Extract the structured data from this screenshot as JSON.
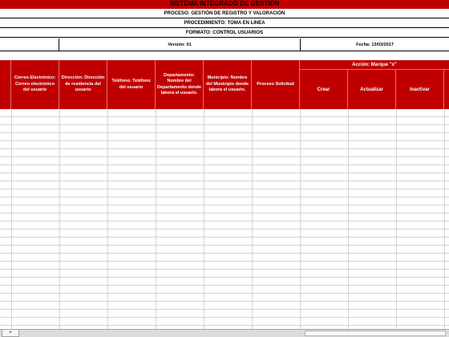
{
  "header": {
    "system_title": "SISTEMA INTEGRADO DE GESTIÓN",
    "proceso": "PROCESO: GESTIÓN DE REGISTRO Y VALORACIÓN",
    "procedimiento": "PROCEDIMIENTO: TOMA EN LINEA",
    "formato": "FORMATO: CONTROL USUARIOS",
    "version": "Versión: 01",
    "fecha": "Fecha: 13/03/2017"
  },
  "table": {
    "columns": [
      "Correo Electrónico: Correo electrónico del usuario",
      "Dirección: Dirección de residencia del usuario",
      "Teléfono: Teléfono del usuario",
      "Departamento: Nombre del Departamento donde labora el usuario.",
      "Municipio: Nombre del Municipio donde labora el usuario.",
      "Proceso Solicitud"
    ],
    "accion_title": "Acción: Marque \"x\"",
    "accion_options": [
      "Crear",
      "Actualizar",
      "Inactivar"
    ]
  },
  "sheet_tabs": [
    "+"
  ]
}
